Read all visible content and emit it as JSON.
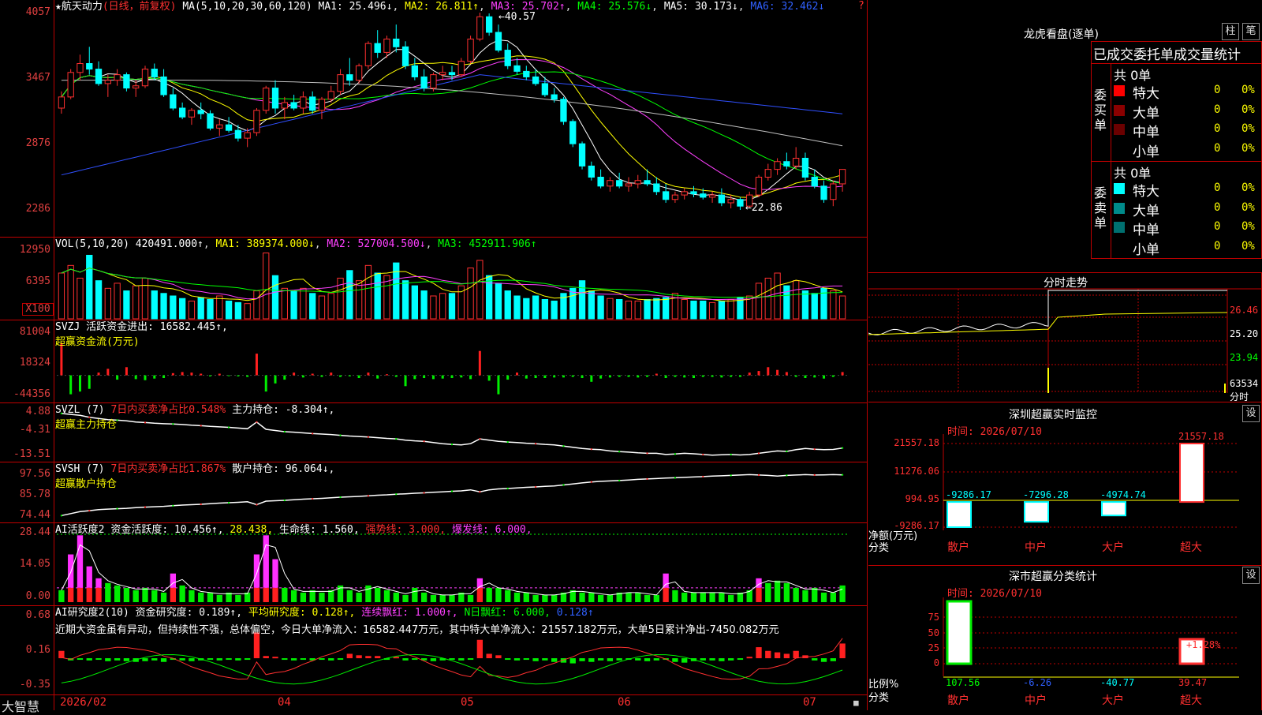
{
  "app": {
    "name": "大智慧"
  },
  "main_header": {
    "stock": "★航天动力",
    "period": "(日线，前复权)",
    "ma_spec": "MA(5,10,20,30,60,120)",
    "ma1": "MA1: 25.496↓",
    "ma2": "MA2: 26.811↑",
    "ma3": "MA3: 25.702↑",
    "ma4": "MA4: 25.576↓",
    "ma5": "MA5: 30.173↓",
    "ma6": "MA6: 32.462↓",
    "high_label": "←40.57",
    "low_label": "←22.86"
  },
  "vol_header": {
    "name": "VOL(5,10,20)",
    "val": "420491.000↑",
    "ma1": "MA1: 389374.000↓",
    "ma2": "MA2: 527004.500↓",
    "ma3": "MA3: 452911.906↑",
    "unit": "X100"
  },
  "svzj_header": {
    "line1": "SVZJ  活跃资金进出: 16582.445↑,",
    "line2": "超赢资金流(万元)"
  },
  "svzl_header": {
    "name": "SVZL (7)",
    "ratio": "7日内买卖净占比0.548%",
    "hold": "主力持仓: -8.304↑,",
    "line2": "超赢主力持仓"
  },
  "svsh_header": {
    "name": "SVSH (7)",
    "ratio": "7日内买卖净占比1.867%",
    "hold": "散户持仓: 96.064↓,",
    "line2": "超赢散户持仓"
  },
  "ai2_header": {
    "name": "AI活跃度2",
    "a": "资金活跃度: 10.456↑,",
    "b": "28.438,",
    "c": "生命线: 1.560,",
    "d": "强势线: 3.000,",
    "e": "爆发线: 6.000,"
  },
  "ai3_header": {
    "name": "AI研究度2(10)",
    "a": "资金研究度: 0.189↑,",
    "b": "平均研究度: 0.128↑,",
    "c": "连续飘红: 1.000↑,",
    "d": "N日飘红: 6.000,",
    "e": "0.128↑"
  },
  "ai3_comment": "近期大资金虽有异动，但持续性不强，总体偏空，今日大单净流入：16582.447万元，其中特大单净流入：21557.182万元，大单5日累计净出-7450.082万元",
  "y_labels": {
    "main": [
      "4057",
      "3467",
      "2876",
      "2286"
    ],
    "vol": [
      "12950",
      "6395"
    ],
    "svzj": [
      "81004",
      "18324",
      "-44356"
    ],
    "svzl": [
      "4.88",
      "-4.31",
      "-13.51"
    ],
    "svsh": [
      "97.56",
      "85.78",
      "74.44"
    ],
    "ai2": [
      "28.44",
      "14.05",
      "0.00"
    ],
    "ai3": [
      "0.68",
      "0.16",
      "-0.35"
    ]
  },
  "x_labels": [
    "2026/02",
    "04",
    "05",
    "06",
    "07"
  ],
  "colors": {
    "up": "#ff3030",
    "down": "#00ffff",
    "grid": "#c00000",
    "ma1": "#ffffff",
    "ma2": "#ffff00",
    "ma3": "#ff40ff",
    "ma4": "#00ff00",
    "ma5": "#c0c0c0",
    "ma6": "#3050ff"
  },
  "dragon": {
    "title": "龙虎看盘(逐单)",
    "btn_a": "柱",
    "btn_b": "笔",
    "subtitle": "已成交委托单成交量统计",
    "buy_side": "委买单",
    "sell_side": "委卖单",
    "buy_total": "共 0单",
    "sell_total": "共 0单",
    "buy_rows": [
      {
        "name": "特大",
        "count": "0",
        "pct": "0%",
        "color": "#ff0000"
      },
      {
        "name": "大单",
        "count": "0",
        "pct": "0%",
        "color": "#8b0000"
      },
      {
        "name": "中单",
        "count": "0",
        "pct": "0%",
        "color": "#6b0000"
      },
      {
        "name": "小单",
        "count": "0",
        "pct": "0%",
        "color": ""
      }
    ],
    "sell_rows": [
      {
        "name": "特大",
        "count": "0",
        "pct": "0%",
        "color": "#00ffff"
      },
      {
        "name": "大单",
        "count": "0",
        "pct": "0%",
        "color": "#008b8b"
      },
      {
        "name": "中单",
        "count": "0",
        "pct": "0%",
        "color": "#007070"
      },
      {
        "name": "小单",
        "count": "0",
        "pct": "0%",
        "color": ""
      }
    ]
  },
  "intraday": {
    "title": "分时走势",
    "p1": "26.46",
    "p2": "25.20",
    "p3": "23.94",
    "vol": "63534",
    "unit": "分时"
  },
  "sz_monitor": {
    "title": "深圳超赢实时监控",
    "set": "设",
    "time": "时间: 2026/07/10",
    "y": [
      "21557.18",
      "11276.06",
      "994.95",
      "-9286.17"
    ],
    "ylab1": "净额(万元)",
    "ylab2": "分类",
    "cats": [
      "散户",
      "中户",
      "大户",
      "超大"
    ],
    "vals": [
      "-9286.17",
      "-7296.28",
      "-4974.74",
      "21557.18"
    ]
  },
  "sz_class": {
    "title": "深市超赢分类统计",
    "set": "设",
    "time": "时间: 2026/07/10",
    "y": [
      "75",
      "50",
      "25",
      "0"
    ],
    "ylab1": "比例%",
    "ylab2": "分类",
    "cats": [
      "散户",
      "中户",
      "大户",
      "超大"
    ],
    "vals": [
      "107.56",
      "-6.26",
      "-40.77",
      "39.47"
    ],
    "extra": "+1.28%"
  },
  "chart_data": [
    {
      "type": "candlestick",
      "title": "航天动力 (日线，前复权)",
      "x_labels": [
        "2026/02",
        "04",
        "05",
        "06",
        "07"
      ],
      "ylim": [
        22.0,
        41.0
      ],
      "y_ticks": [
        40.57,
        34.67,
        28.76,
        22.86
      ],
      "candles": [
        [
          32.0,
          33.5,
          31.5,
          33.0
        ],
        [
          33.0,
          35.5,
          32.8,
          35.2
        ],
        [
          35.2,
          36.8,
          34.5,
          36.0
        ],
        [
          36.0,
          37.5,
          35.0,
          35.5
        ],
        [
          35.5,
          36.2,
          34.0,
          34.2
        ],
        [
          34.2,
          35.0,
          33.0,
          34.5
        ],
        [
          34.5,
          35.5,
          34.0,
          35.0
        ],
        [
          35.0,
          35.2,
          33.5,
          33.8
        ],
        [
          33.8,
          34.5,
          33.0,
          34.0
        ],
        [
          34.0,
          35.8,
          33.8,
          35.5
        ],
        [
          35.5,
          36.0,
          34.5,
          34.8
        ],
        [
          34.8,
          35.5,
          33.0,
          33.2
        ],
        [
          33.2,
          33.8,
          31.8,
          32.0
        ],
        [
          32.0,
          32.5,
          31.0,
          31.2
        ],
        [
          31.2,
          32.0,
          30.5,
          31.8
        ],
        [
          31.8,
          32.5,
          31.0,
          31.5
        ],
        [
          31.5,
          31.8,
          30.0,
          30.2
        ],
        [
          30.2,
          31.0,
          29.5,
          30.5
        ],
        [
          30.5,
          31.2,
          29.8,
          30.0
        ],
        [
          30.0,
          30.5,
          29.0,
          29.3
        ],
        [
          29.3,
          30.2,
          28.5,
          29.8
        ],
        [
          29.8,
          32.0,
          29.5,
          31.8
        ],
        [
          31.8,
          34.0,
          31.5,
          33.8
        ],
        [
          33.8,
          34.5,
          31.5,
          32.0
        ],
        [
          32.0,
          33.0,
          31.0,
          32.5
        ],
        [
          32.5,
          33.2,
          31.8,
          32.0
        ],
        [
          32.0,
          33.5,
          31.5,
          33.0
        ],
        [
          33.0,
          33.5,
          31.5,
          31.8
        ],
        [
          31.8,
          33.0,
          31.0,
          32.8
        ],
        [
          32.8,
          34.0,
          32.5,
          33.5
        ],
        [
          33.5,
          35.5,
          33.2,
          35.0
        ],
        [
          35.0,
          36.5,
          34.0,
          34.5
        ],
        [
          34.5,
          36.0,
          34.2,
          35.8
        ],
        [
          35.8,
          38.0,
          35.5,
          37.8
        ],
        [
          37.8,
          39.0,
          36.5,
          37.0
        ],
        [
          37.0,
          38.5,
          36.5,
          38.2
        ],
        [
          38.2,
          39.5,
          37.0,
          37.5
        ],
        [
          37.5,
          38.0,
          35.5,
          35.8
        ],
        [
          35.8,
          36.5,
          34.5,
          34.8
        ],
        [
          34.8,
          35.5,
          33.5,
          33.8
        ],
        [
          33.8,
          35.2,
          33.5,
          35.0
        ],
        [
          35.0,
          35.8,
          34.5,
          35.2
        ],
        [
          35.2,
          35.8,
          34.5,
          35.0
        ],
        [
          35.0,
          36.5,
          34.8,
          36.2
        ],
        [
          36.2,
          38.5,
          36.0,
          38.2
        ],
        [
          38.2,
          40.57,
          38.0,
          40.2
        ],
        [
          40.2,
          40.5,
          38.5,
          38.8
        ],
        [
          38.8,
          39.5,
          37.0,
          37.2
        ],
        [
          37.2,
          37.8,
          35.5,
          35.8
        ],
        [
          35.8,
          36.5,
          35.0,
          35.3
        ],
        [
          35.3,
          35.8,
          34.5,
          34.8
        ],
        [
          34.8,
          35.5,
          34.0,
          34.2
        ],
        [
          34.2,
          34.8,
          33.0,
          33.2
        ],
        [
          33.2,
          33.8,
          32.5,
          32.8
        ],
        [
          32.8,
          33.0,
          30.5,
          30.8
        ],
        [
          30.8,
          31.0,
          28.5,
          28.8
        ],
        [
          28.8,
          29.0,
          26.5,
          26.8
        ],
        [
          26.8,
          27.2,
          25.5,
          25.8
        ],
        [
          25.8,
          26.5,
          24.8,
          25.0
        ],
        [
          25.0,
          25.8,
          24.5,
          25.5
        ],
        [
          25.5,
          26.2,
          24.8,
          25.0
        ],
        [
          25.0,
          25.8,
          24.5,
          25.2
        ],
        [
          25.2,
          26.0,
          24.8,
          25.5
        ],
        [
          25.5,
          26.5,
          25.0,
          25.2
        ],
        [
          25.2,
          25.8,
          24.2,
          24.5
        ],
        [
          24.5,
          25.2,
          23.5,
          23.8
        ],
        [
          23.8,
          24.5,
          23.5,
          24.2
        ],
        [
          24.2,
          24.8,
          23.8,
          24.5
        ],
        [
          24.5,
          25.0,
          24.0,
          24.3
        ],
        [
          24.3,
          24.8,
          23.8,
          24.0
        ],
        [
          24.0,
          24.5,
          23.5,
          24.2
        ],
        [
          24.2,
          24.8,
          23.2,
          23.5
        ],
        [
          23.5,
          24.2,
          23.0,
          23.8
        ],
        [
          23.8,
          24.0,
          22.86,
          23.2
        ],
        [
          23.2,
          24.5,
          23.0,
          24.2
        ],
        [
          24.2,
          26.0,
          24.0,
          25.8
        ],
        [
          25.8,
          27.0,
          25.5,
          26.5
        ],
        [
          26.5,
          27.5,
          26.0,
          27.2
        ],
        [
          27.2,
          28.0,
          26.5,
          26.8
        ],
        [
          26.8,
          28.5,
          26.5,
          27.5
        ],
        [
          27.5,
          28.0,
          25.5,
          25.8
        ],
        [
          25.8,
          26.5,
          24.8,
          25.0
        ],
        [
          25.0,
          25.5,
          23.5,
          23.8
        ],
        [
          23.8,
          25.5,
          23.2,
          25.2
        ],
        [
          25.2,
          26.5,
          24.5,
          26.5
        ]
      ]
    },
    {
      "type": "bar",
      "title": "VOL(5,10,20)",
      "ylim": [
        0,
        13500
      ],
      "values": [
        9000,
        10500,
        8000,
        12500,
        7500,
        6000,
        7000,
        5500,
        6500,
        8000,
        5500,
        5000,
        4500,
        4000,
        3500,
        4200,
        3800,
        4500,
        3500,
        3200,
        3000,
        5500,
        12950,
        8500,
        6000,
        5500,
        6000,
        5000,
        4500,
        5000,
        8000,
        9500,
        7500,
        10500,
        9000,
        8500,
        11000,
        7500,
        6500,
        5500,
        4500,
        5000,
        5000,
        6500,
        10000,
        11500,
        8500,
        7000,
        5500,
        4500,
        4000,
        4500,
        3800,
        3500,
        5000,
        6000,
        7500,
        5500,
        4500,
        4000,
        3800,
        3500,
        3500,
        3800,
        4000,
        4200,
        5000,
        3800,
        3500,
        3500,
        3200,
        3500,
        3800,
        4200,
        4500,
        7000,
        8000,
        9000,
        6500,
        7500,
        5500,
        5000,
        6000,
        5500,
        4500
      ]
    },
    {
      "type": "bar",
      "title": "超赢资金流(万元)",
      "ylim": [
        -44356,
        81004
      ],
      "values": [
        60000,
        -35000,
        -30000,
        -25000,
        5000,
        12000,
        -8000,
        15000,
        -7000,
        -9000,
        -6000,
        -5000,
        4000,
        6000,
        5000,
        3000,
        -2000,
        3000,
        -1500,
        -2000,
        -3000,
        40000,
        -30000,
        -15000,
        -8000,
        5000,
        -4000,
        3000,
        -3000,
        5000,
        -3000,
        -2000,
        -5000,
        5000,
        -6000,
        2000,
        -3000,
        -20000,
        -7000,
        -5000,
        -7000,
        -6000,
        -5000,
        -4000,
        -7000,
        45000,
        -10000,
        -35000,
        -8000,
        5000,
        -6000,
        -5000,
        -5000,
        -4000,
        -4000,
        -3000,
        -5000,
        -12000,
        -6000,
        -4000,
        -3000,
        -3000,
        -4000,
        -3000,
        3000,
        -5000,
        -3000,
        -4000,
        -5000,
        -3000,
        -3000,
        -4000,
        -3000,
        -3000,
        5000,
        8000,
        15000,
        10000,
        6000,
        -3000,
        -5000,
        -4000,
        -6000,
        -3000,
        6000
      ]
    },
    {
      "type": "line",
      "title": "超赢主力持仓",
      "ylim": [
        -13.51,
        4.88
      ],
      "values": [
        4.6,
        4.2,
        3.8,
        3.0,
        2.5,
        2.0,
        1.8,
        1.5,
        1.0,
        0.8,
        0.5,
        0.3,
        0.2,
        0.0,
        -0.3,
        -0.5,
        -0.8,
        -1.0,
        -1.2,
        -1.5,
        -1.8,
        1.0,
        -2.0,
        -2.5,
        -3.0,
        -3.2,
        -3.5,
        -3.8,
        -4.0,
        -4.2,
        -4.5,
        -4.8,
        -5.0,
        -5.2,
        -5.5,
        -5.8,
        -6.0,
        -6.5,
        -6.8,
        -7.0,
        -7.5,
        -8.0,
        -8.3,
        -8.5,
        -8.0,
        -6.0,
        -6.5,
        -7.0,
        -7.3,
        -7.5,
        -7.8,
        -8.0,
        -8.3,
        -8.5,
        -9.0,
        -9.5,
        -10.0,
        -10.3,
        -10.5,
        -11.0,
        -11.3,
        -11.5,
        -11.8,
        -12.0,
        -12.0,
        -12.5,
        -12.3,
        -12.0,
        -12.2,
        -12.5,
        -12.8,
        -12.6,
        -12.5,
        -12.7,
        -12.5,
        -12.0,
        -11.5,
        -11.0,
        -11.2,
        -10.5,
        -10.0,
        -10.3,
        -10.5,
        -10.4,
        -9.8
      ]
    },
    {
      "type": "line",
      "title": "超赢散户持仓",
      "ylim": [
        74.44,
        97.56
      ],
      "values": [
        75.5,
        76.5,
        77.5,
        78.0,
        78.5,
        78.8,
        79.0,
        79.2,
        79.5,
        79.8,
        80.0,
        80.2,
        80.5,
        80.8,
        81.0,
        81.2,
        81.5,
        81.8,
        82.0,
        82.2,
        82.5,
        81.0,
        82.8,
        83.0,
        83.2,
        83.5,
        83.8,
        84.0,
        84.2,
        84.5,
        84.8,
        85.0,
        85.2,
        85.5,
        85.8,
        86.0,
        86.3,
        86.5,
        86.8,
        87.0,
        87.3,
        87.5,
        87.8,
        88.0,
        88.5,
        87.5,
        88.5,
        89.0,
        89.2,
        89.5,
        89.8,
        90.0,
        90.3,
        90.5,
        91.0,
        91.5,
        92.0,
        92.5,
        92.8,
        93.0,
        93.2,
        93.5,
        93.8,
        94.0,
        94.2,
        94.5,
        94.6,
        94.8,
        95.0,
        95.2,
        95.5,
        95.6,
        95.8,
        96.0,
        96.2,
        96.0,
        95.8,
        95.5,
        95.8,
        96.0,
        96.2,
        96.0,
        96.1,
        96.2,
        96.1
      ]
    },
    {
      "type": "bar",
      "title": "AI活跃度2",
      "ylim": [
        0,
        28.44
      ],
      "values": [
        5,
        20,
        28,
        15,
        10,
        8,
        7,
        6,
        5,
        6,
        5,
        4,
        12,
        7,
        5,
        4,
        4,
        3,
        4,
        3,
        4,
        20,
        28,
        18,
        6,
        5,
        4,
        5,
        4,
        5,
        7,
        5,
        4,
        7,
        6,
        5,
        4,
        3,
        6,
        4,
        3,
        3,
        3,
        4,
        3,
        10,
        6,
        6,
        5,
        4,
        4,
        3,
        3,
        3,
        4,
        5,
        4,
        4,
        3,
        3,
        4,
        4,
        4,
        3,
        3,
        12,
        5,
        4,
        4,
        4,
        4,
        4,
        3,
        4,
        5,
        10,
        8,
        9,
        8,
        6,
        5,
        6,
        4,
        4,
        7
      ]
    },
    {
      "type": "bar",
      "title": "AI研究度2(10)",
      "ylim": [
        -0.35,
        0.68
      ],
      "values": [
        0.1,
        -0.03,
        -0.02,
        -0.03,
        -0.02,
        -0.04,
        -0.03,
        -0.04,
        -0.05,
        -0.04,
        -0.03,
        -0.05,
        -0.02,
        -0.03,
        -0.04,
        -0.03,
        -0.02,
        -0.03,
        -0.02,
        -0.03,
        -0.02,
        0.35,
        0.03,
        0.02,
        -0.02,
        -0.03,
        -0.02,
        -0.03,
        -0.02,
        -0.03,
        -0.02,
        0.06,
        0.04,
        0.03,
        0.03,
        -0.02,
        0.02,
        -0.03,
        -0.02,
        -0.03,
        -0.04,
        -0.03,
        -0.02,
        -0.03,
        -0.02,
        0.25,
        0.06,
        0.04,
        -0.02,
        -0.03,
        -0.02,
        -0.04,
        -0.03,
        -0.05,
        -0.06,
        -0.07,
        -0.04,
        -0.05,
        -0.03,
        -0.04,
        -0.03,
        -0.02,
        -0.03,
        -0.04,
        -0.03,
        -0.02,
        -0.05,
        -0.06,
        -0.04,
        -0.03,
        -0.03,
        -0.04,
        -0.03,
        -0.02,
        0.02,
        0.15,
        0.1,
        0.08,
        0.06,
        0.1,
        0.04,
        -0.03,
        -0.05,
        -0.04,
        0.2
      ]
    }
  ]
}
